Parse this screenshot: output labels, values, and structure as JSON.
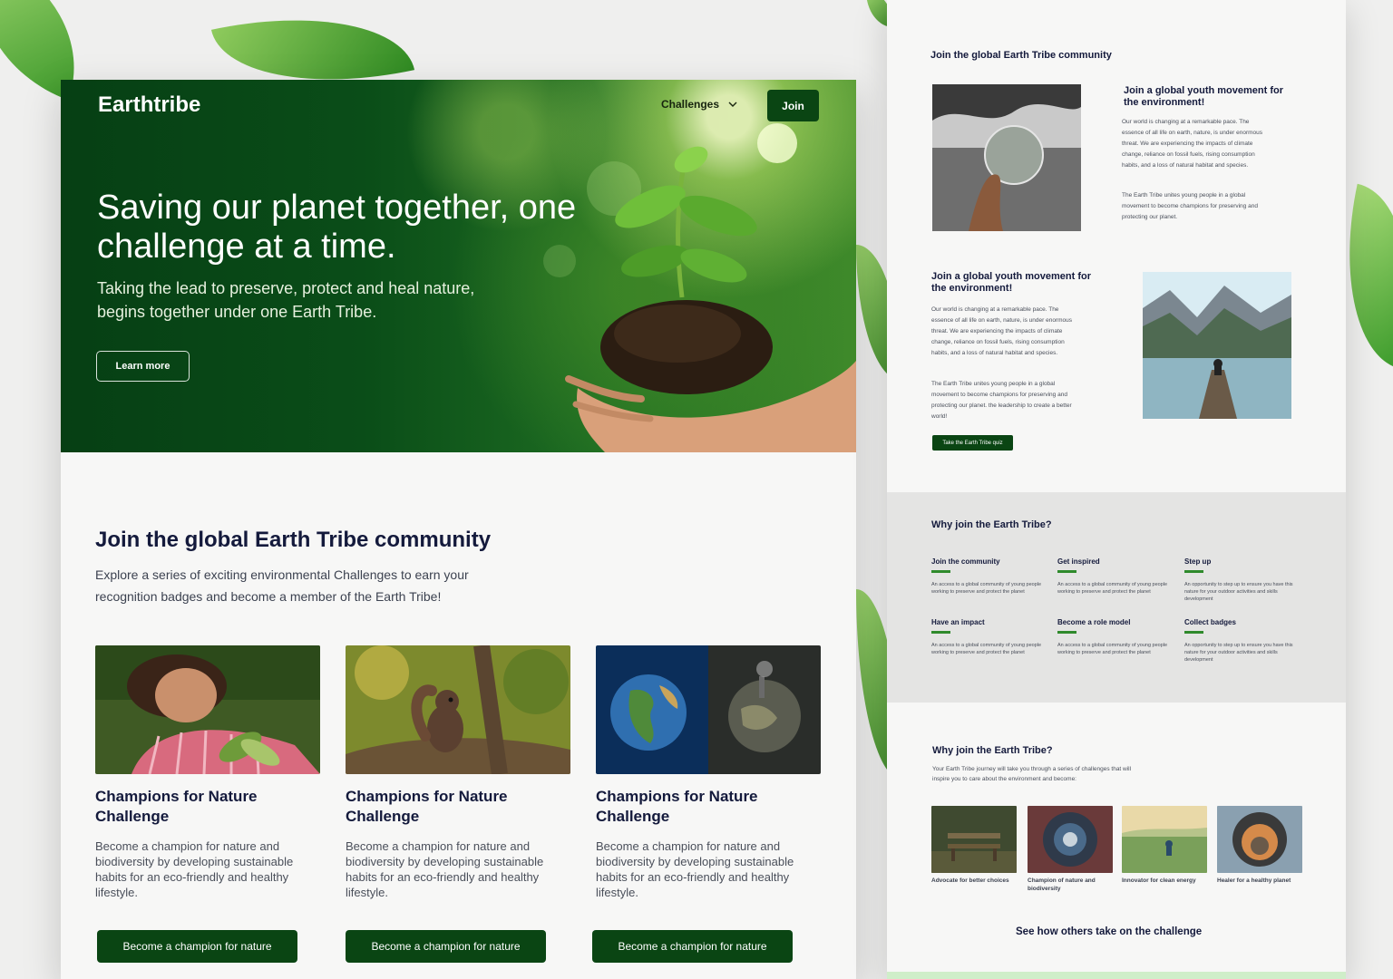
{
  "header": {
    "brand": "Earthtribe",
    "nav_challenges": "Challenges",
    "join_label": "Join"
  },
  "hero": {
    "title": "Saving our planet together, one challenge at a time.",
    "subtitle": "Taking the lead to preserve, protect and heal nature, begins together under one Earth Tribe.",
    "cta_label": "Learn more"
  },
  "community": {
    "title": "Join the global Earth Tribe community",
    "subtitle": "Explore a series of exciting environmental Challenges to earn your recognition badges and become a member of the Earth Tribe!",
    "cards": [
      {
        "title": "Champions for Nature Challenge",
        "text": "Become a champion for nature and biodiversity by developing sustainable habits for an eco-friendly and healthy lifestyle.",
        "button": "Become a champion for nature"
      },
      {
        "title": "Champions for Nature Challenge",
        "text": "Become a champion for nature and biodiversity by developing sustainable habits for an eco-friendly and healthy lifestyle.",
        "button": "Become a champion for nature"
      },
      {
        "title": "Champions for Nature Challenge",
        "text": "Become a champion for nature and biodiversity by developing sustainable habits for an eco-friendly and healthy lifestyle.",
        "button": "Become a champion for nature"
      }
    ]
  },
  "side": {
    "community_title": "Join the global Earth Tribe community",
    "movement_title": "Join a global youth movement for the environment!",
    "movement_p1": "Our world is changing at a remarkable pace. The essence of all life on earth, nature, is under enormous threat. We are experiencing the impacts of climate change, reliance on fossil fuels, rising consumption habits, and a loss of natural habitat and species.",
    "movement_p2": "The Earth Tribe unites young people in a global movement to become champions for preserving and protecting our planet.",
    "movement2_title": "Join a global youth movement for the environment!",
    "movement2_p1": "Our world is changing at a remarkable pace. The essence of all life on earth, nature, is under enormous threat. We are experiencing the impacts of climate change, reliance on fossil fuels, rising consumption habits, and a loss of natural habitat and species.",
    "movement2_p2": "The Earth Tribe unites young people in a global movement to become champions for preserving and protecting our planet. the leadership to create a better world!",
    "quiz_label": "Take the Earth Tribe quiz",
    "why_title": "Why join the Earth Tribe?",
    "benefits": [
      {
        "title": "Join the community",
        "text": "An access to a global community of young people working to preserve and protect the planet"
      },
      {
        "title": "Get inspired",
        "text": "An access to a global community of young people working to preserve and protect the planet"
      },
      {
        "title": "Step up",
        "text": "An opportunity to step up to ensure you have this nature for your outdoor activities and skills development"
      },
      {
        "title": "Have an impact",
        "text": "An access to a global community of young people working to preserve and protect the planet"
      },
      {
        "title": "Become a role model",
        "text": "An access to a global community of young people working to preserve and protect the planet"
      },
      {
        "title": "Collect badges",
        "text": "An opportunity to step up to ensure you have this nature for your outdoor activities and skills development"
      }
    ],
    "why2_title": "Why join the Earth Tribe?",
    "why2_sub": "Your Earth Tribe journey will take you through a series of challenges that will inspire you to care about the environment and become:",
    "roles": [
      {
        "label": "Advocate for better choices"
      },
      {
        "label": "Champion of nature and biodiversity"
      },
      {
        "label": "Innovator for clean energy"
      },
      {
        "label": "Healer for a healthy planet"
      }
    ],
    "see_others": "See how others take on the challenge"
  },
  "colors": {
    "brand_green": "#0a4513",
    "accent_green": "#2f8a2c",
    "heading_navy": "#141a3c"
  },
  "icons": {
    "nav_dropdown": "chevron-down-icon"
  }
}
